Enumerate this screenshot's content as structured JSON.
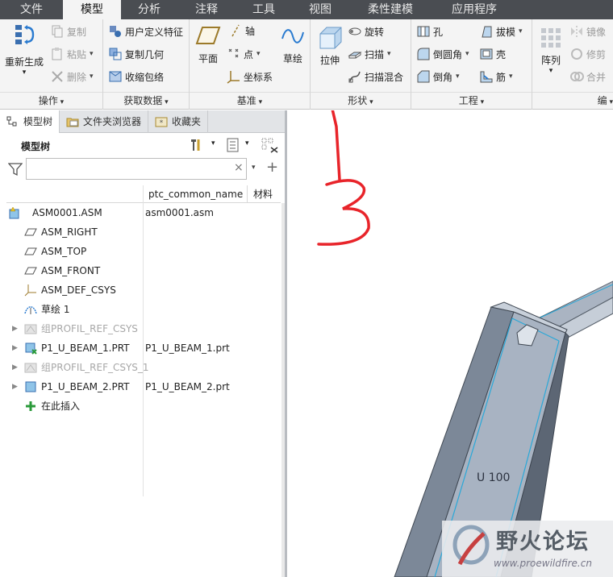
{
  "menu": {
    "tabs": [
      "文件",
      "模型",
      "分析",
      "注释",
      "工具",
      "视图",
      "柔性建模",
      "应用程序"
    ]
  },
  "ribbon": {
    "operations": {
      "label": "操作",
      "regenerate": "重新生成",
      "copy": "复制",
      "paste": "粘贴",
      "delete": "删除"
    },
    "get_data": {
      "label": "获取数据",
      "udf": "用户定义特征",
      "copy_geom": "复制几何",
      "shrinkwrap": "收缩包络"
    },
    "datum": {
      "label": "基准",
      "plane": "平面",
      "axis": "轴",
      "point": "点",
      "csys": "坐标系",
      "sketch": "草绘"
    },
    "shapes": {
      "label": "形状",
      "extrude": "拉伸",
      "revolve": "旋转",
      "sweep": "扫描",
      "swept_blend": "扫描混合"
    },
    "engineering": {
      "label": "工程",
      "hole": "孔",
      "round": "倒圆角",
      "chamfer": "倒角",
      "draft": "拔模",
      "shell": "壳",
      "rib": "筋"
    },
    "editing": {
      "label": "编",
      "pattern": "阵列",
      "mirror": "镜像",
      "trim": "修剪",
      "merge": "合并"
    }
  },
  "panel": {
    "tabs": [
      "模型树",
      "文件夹浏览器",
      "收藏夹"
    ],
    "tree_title": "模型树",
    "filter_placeholder": "",
    "columns": [
      "ptc_common_name",
      "材料"
    ],
    "rows": [
      {
        "name": "ASM0001.ASM",
        "common": "asm0001.asm",
        "icon": "assembly-icon",
        "expandable": false,
        "grey": false
      },
      {
        "name": "ASM_RIGHT",
        "common": "",
        "icon": "datum-plane-icon",
        "expandable": false,
        "grey": false
      },
      {
        "name": "ASM_TOP",
        "common": "",
        "icon": "datum-plane-icon",
        "expandable": false,
        "grey": false
      },
      {
        "name": "ASM_FRONT",
        "common": "",
        "icon": "datum-plane-icon",
        "expandable": false,
        "grey": false
      },
      {
        "name": "ASM_DEF_CSYS",
        "common": "",
        "icon": "csys-icon",
        "expandable": false,
        "grey": false
      },
      {
        "name": "草绘 1",
        "common": "",
        "icon": "sketch-icon",
        "expandable": false,
        "grey": false
      },
      {
        "name": "组PROFIL_REF_CSYS",
        "common": "",
        "icon": "group-icon",
        "expandable": true,
        "grey": true
      },
      {
        "name": "P1_U_BEAM_1.PRT",
        "common": "P1_U_BEAM_1.prt",
        "icon": "part-icon",
        "expandable": true,
        "grey": false
      },
      {
        "name": "组PROFIL_REF_CSYS_1",
        "common": "",
        "icon": "group-icon",
        "expandable": true,
        "grey": true
      },
      {
        "name": "P1_U_BEAM_2.PRT",
        "common": "P1_U_BEAM_2.prt",
        "icon": "part-icon",
        "expandable": true,
        "grey": false
      },
      {
        "name": "在此插入",
        "common": "",
        "icon": "insert-here-icon",
        "expandable": false,
        "grey": false
      }
    ]
  },
  "viewport": {
    "annotation": "13",
    "beam_label": "U 100"
  },
  "watermark": {
    "title": "野火论坛",
    "url": "www.proewildfire.cn"
  },
  "colors": {
    "menubar": "#4a4d52",
    "ribbon": "#f4f4f4",
    "annotation": "#e8242a",
    "beam": "#8a98aa",
    "beam_edge": "#2aa8d8"
  }
}
